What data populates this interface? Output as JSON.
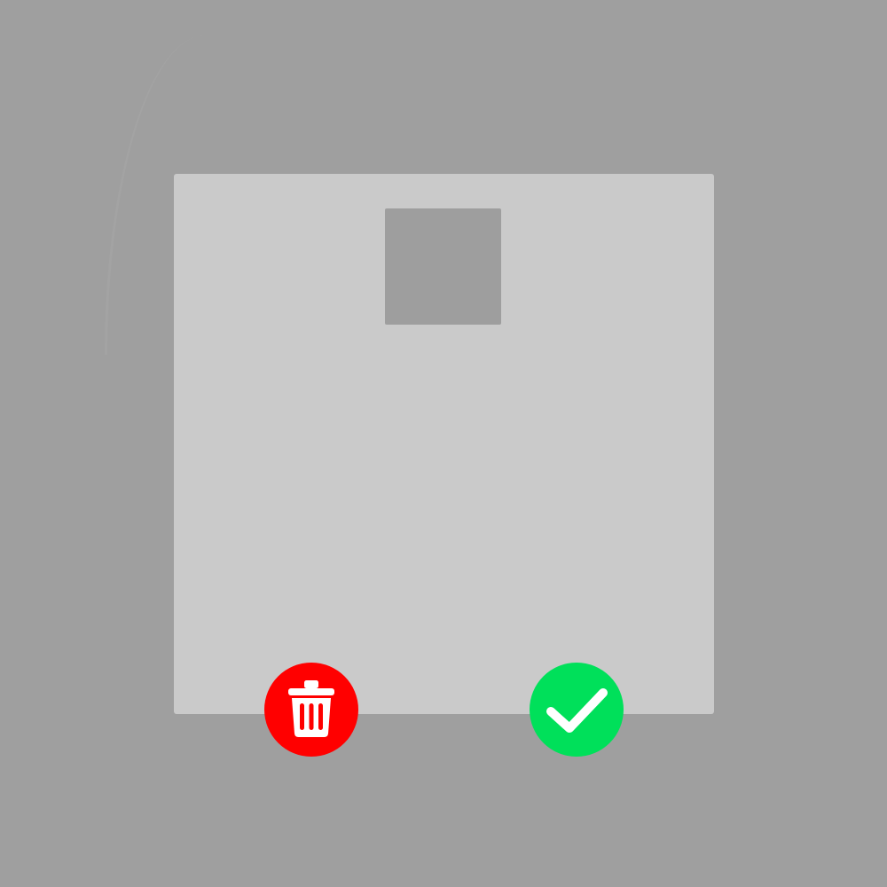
{
  "dialog": {
    "actions": {
      "delete": {
        "icon": "trash-icon",
        "color": "#ff0000"
      },
      "confirm": {
        "icon": "checkmark-icon",
        "color": "#00e05a"
      }
    }
  },
  "colors": {
    "backdrop": "#9f9f9f",
    "card": "#cacaca",
    "thumbnail": "#9e9e9e",
    "icon": "#ffffff"
  }
}
